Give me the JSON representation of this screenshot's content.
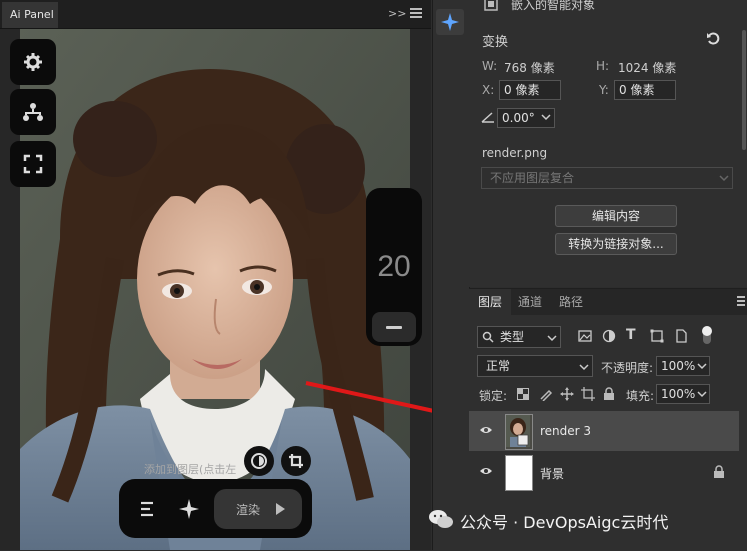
{
  "ai_panel": {
    "tab_title": "Ai Panel",
    "collapse_arrows": ">>",
    "counter_value": "20",
    "add_to_layer_hint": "添加到图层(点击左",
    "render_label": "渲染"
  },
  "properties": {
    "top_title": "嵌入的智能对象",
    "transform_title": "变换",
    "w_label": "W:",
    "w_value": "768 像素",
    "h_label": "H:",
    "h_value": "1024 像素",
    "x_label": "X:",
    "x_value": "0 像素",
    "y_label": "Y:",
    "y_value": "0 像素",
    "angle_value": "0.00°",
    "filename": "render.png",
    "layer_comp_placeholder": "不应用图层复合",
    "edit_contents_button": "编辑内容",
    "convert_linked_button": "转换为链接对象..."
  },
  "layers_panel": {
    "tabs": [
      "图层",
      "通道",
      "路径"
    ],
    "filter_kind": "类型",
    "blend_mode": "正常",
    "opacity_label": "不透明度:",
    "opacity_value": "100%",
    "lock_label": "锁定:",
    "fill_label": "填充:",
    "fill_value": "100%",
    "layers": [
      {
        "name": "render 3",
        "selected": true
      },
      {
        "name": "背景",
        "locked": true
      }
    ]
  },
  "watermark": {
    "text": "公众号 · DevOpsAigc云时代"
  },
  "colors": {
    "annotation_arrow": "#e01818",
    "panel_bg": "#2f2f2f",
    "selected_layer_bg": "#4a4a4a"
  }
}
